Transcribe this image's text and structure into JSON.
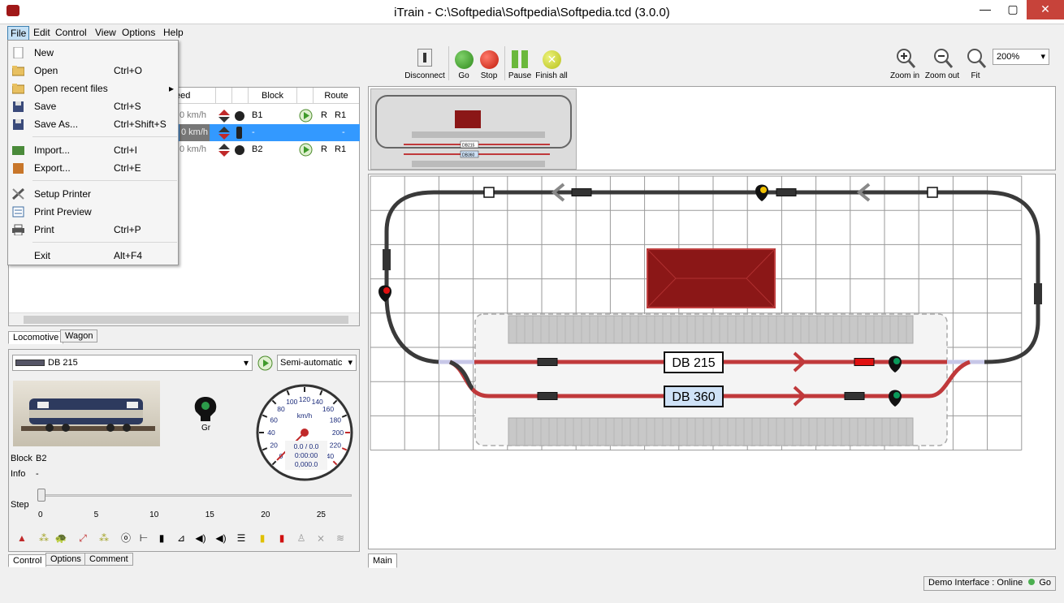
{
  "window": {
    "title": "iTrain - C:\\Softpedia\\Softpedia\\Softpedia.tcd (3.0.0)",
    "min": "—",
    "max": "▢",
    "close": "✕"
  },
  "menubar": [
    "File",
    "Edit",
    "Control",
    "View",
    "Options",
    "Help"
  ],
  "file_menu": [
    {
      "label": "New",
      "shortcut": "",
      "icon": "new-file-icon"
    },
    {
      "label": "Open",
      "shortcut": "Ctrl+O",
      "icon": "open-folder-icon"
    },
    {
      "label": "Open recent files",
      "shortcut": "",
      "icon": "recent-folder-icon",
      "submenu": true
    },
    {
      "label": "Save",
      "shortcut": "Ctrl+S",
      "icon": "save-icon"
    },
    {
      "label": "Save As...",
      "shortcut": "Ctrl+Shift+S",
      "icon": "save-as-icon"
    },
    {
      "label": "Import...",
      "shortcut": "Ctrl+I",
      "icon": "import-icon"
    },
    {
      "label": "Export...",
      "shortcut": "Ctrl+E",
      "icon": "export-icon"
    },
    {
      "label": "Setup Printer",
      "shortcut": "",
      "icon": "setup-printer-icon"
    },
    {
      "label": "Print Preview",
      "shortcut": "",
      "icon": "print-preview-icon"
    },
    {
      "label": "Print",
      "shortcut": "Ctrl+P",
      "icon": "printer-icon"
    },
    {
      "label": "Exit",
      "shortcut": "Alt+F4",
      "icon": ""
    }
  ],
  "submenu_arrow": "▸",
  "toolbar": {
    "disconnect": "Disconnect",
    "go": "Go",
    "stop": "Stop",
    "pause": "Pause",
    "finish_all": "Finish all",
    "zoom_in": "Zoom in",
    "zoom_out": "Zoom out",
    "fit": "Fit",
    "zoom_level": "200%"
  },
  "loco_table": {
    "headers": {
      "speed": "eed",
      "block": "Block",
      "route": "Route"
    },
    "rows": [
      {
        "speed": "0 km/h",
        "block": "B1",
        "dir": "R",
        "route": "R1"
      },
      {
        "speed": "0 km/h",
        "block": "-",
        "dir": "",
        "route": "-"
      },
      {
        "speed": "0 km/h",
        "block": "B2",
        "dir": "R",
        "route": "R1"
      }
    ],
    "selected_row": 1
  },
  "loco_tabs": [
    "Locomotive",
    "Wagon"
  ],
  "control": {
    "loco_name": "DB 215",
    "mode": "Semi-automatic",
    "signal_label": "Gr",
    "block_label": "Block",
    "block_value": "B2",
    "info_label": "Info",
    "info_value": "-",
    "step_label": "Step",
    "step_value": 0,
    "step_ticks": [
      "0",
      "5",
      "10",
      "15",
      "20",
      "25"
    ],
    "speed_ticks": [
      "0",
      "20",
      "40",
      "60",
      "80",
      "100",
      "120",
      "140",
      "160",
      "180",
      "200",
      "220",
      "240"
    ],
    "speed_unit": "km/h",
    "readout": [
      "0.0 / 0.0",
      "0:00:00",
      "0,000.0"
    ],
    "speed_value": 0,
    "chevron": "▾"
  },
  "control_tabs": [
    "Control",
    "Options",
    "Comment"
  ],
  "function_icons": [
    "▲",
    "⁂",
    "🐢",
    "⤢",
    "⁂",
    "ⓞ",
    "⊢",
    "▮",
    "⊿",
    "◀)",
    "◀)",
    "☰",
    "▮",
    "▮",
    "♙",
    "⨯",
    "≋"
  ],
  "switchboard": {
    "trains": [
      "DB 215",
      "DB 360"
    ],
    "tab": "Main"
  },
  "minimap_labels": [
    "DB215",
    "DB360"
  ],
  "status": {
    "text": "Demo Interface :  Online",
    "state": "Go",
    "color": "#4caf50"
  },
  "colors": {
    "track": "#3a3a3a",
    "occupied": "#c0393b",
    "station": "#8b1717",
    "selection": "#3399ff",
    "green": "#3f9a2a",
    "red": "#d12a1a"
  }
}
